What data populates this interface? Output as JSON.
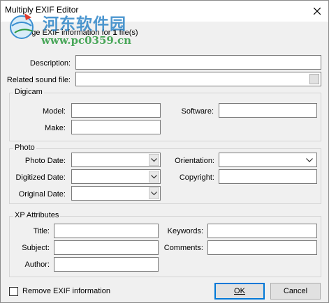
{
  "window": {
    "title": "Multiply EXIF Editor"
  },
  "watermark": {
    "site_name": "河东软件园",
    "url": "www.pc0359.cn"
  },
  "header": {
    "text_before": "Change EXIF information for ",
    "file_count": "1",
    "text_after": " file(s)"
  },
  "general": {
    "description_label": "Description:",
    "description_value": "",
    "sound_label": "Related sound file:",
    "sound_value": ""
  },
  "digicam": {
    "title": "Digicam",
    "model_label": "Model:",
    "make_label": "Make:",
    "software_label": "Software:"
  },
  "photo": {
    "title": "Photo",
    "photo_date_label": "Photo Date:",
    "digitized_date_label": "Digitized Date:",
    "original_date_label": "Original Date:",
    "orientation_label": "Orientation:",
    "copyright_label": "Copyright:"
  },
  "xp": {
    "title": "XP Attributes",
    "title_label": "Title:",
    "subject_label": "Subject:",
    "author_label": "Author:",
    "keywords_label": "Keywords:",
    "comments_label": "Comments:"
  },
  "footer": {
    "remove_exif_label": "Remove EXIF information",
    "remove_exif_checked": false,
    "ok_label": "OK",
    "cancel_label": "Cancel"
  },
  "icons": {
    "close": "close-icon",
    "dropdown": "chevron-down-icon",
    "logo": "globe-logo-icon"
  }
}
